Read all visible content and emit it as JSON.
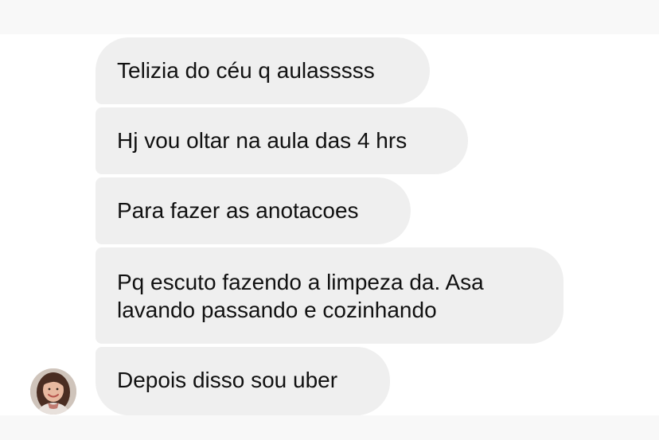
{
  "messages": [
    {
      "text": "Telizia do céu q aulasssss"
    },
    {
      "text": "Hj vou oltar na aula das 4 hrs"
    },
    {
      "text": "Para fazer as anotacoes"
    },
    {
      "text": "Pq escuto fazendo a limpeza da. Asa\nlavando passando e cozinhando"
    },
    {
      "text": "Depois disso sou uber"
    }
  ],
  "colors": {
    "bubble_bg": "#efefef",
    "page_bg": "#ffffff",
    "band_bg": "#f8f8f8",
    "text": "#111111"
  },
  "avatar": {
    "icon": "user-avatar-photo"
  }
}
